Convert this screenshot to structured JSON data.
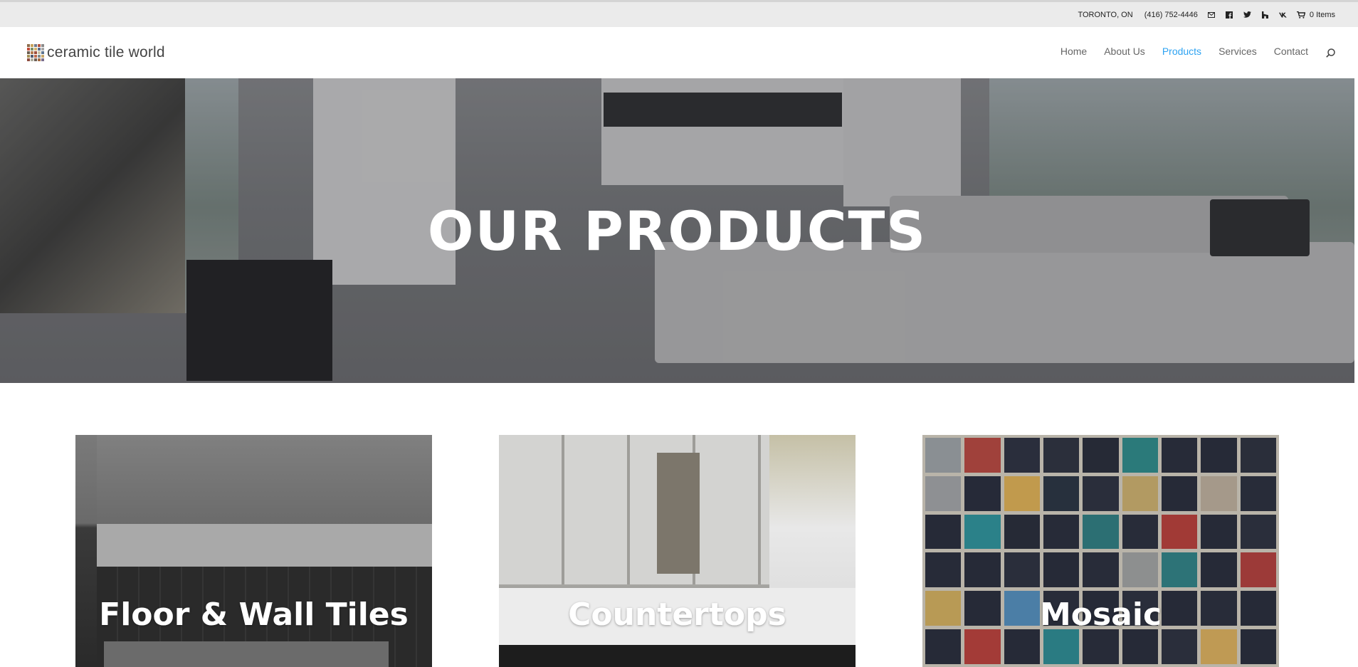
{
  "topbar": {
    "location": "TORONTO, ON",
    "phone": "(416) 752-4446",
    "icons": [
      "email-icon",
      "facebook-icon",
      "twitter-icon",
      "houzz-icon",
      "vk-icon"
    ],
    "cart_label": "0 Items"
  },
  "header": {
    "logo_text": "ceramic tile world",
    "nav": [
      {
        "label": "Home",
        "active": false
      },
      {
        "label": "About Us",
        "active": false
      },
      {
        "label": "Products",
        "active": true
      },
      {
        "label": "Services",
        "active": false
      },
      {
        "label": "Contact",
        "active": false
      }
    ],
    "accent_color": "#2ea3f2"
  },
  "hero": {
    "title": "OUR PRODUCTS"
  },
  "products": [
    {
      "title": "Floor & Wall Tiles"
    },
    {
      "title": "Countertops"
    },
    {
      "title": "Mosaic"
    }
  ]
}
